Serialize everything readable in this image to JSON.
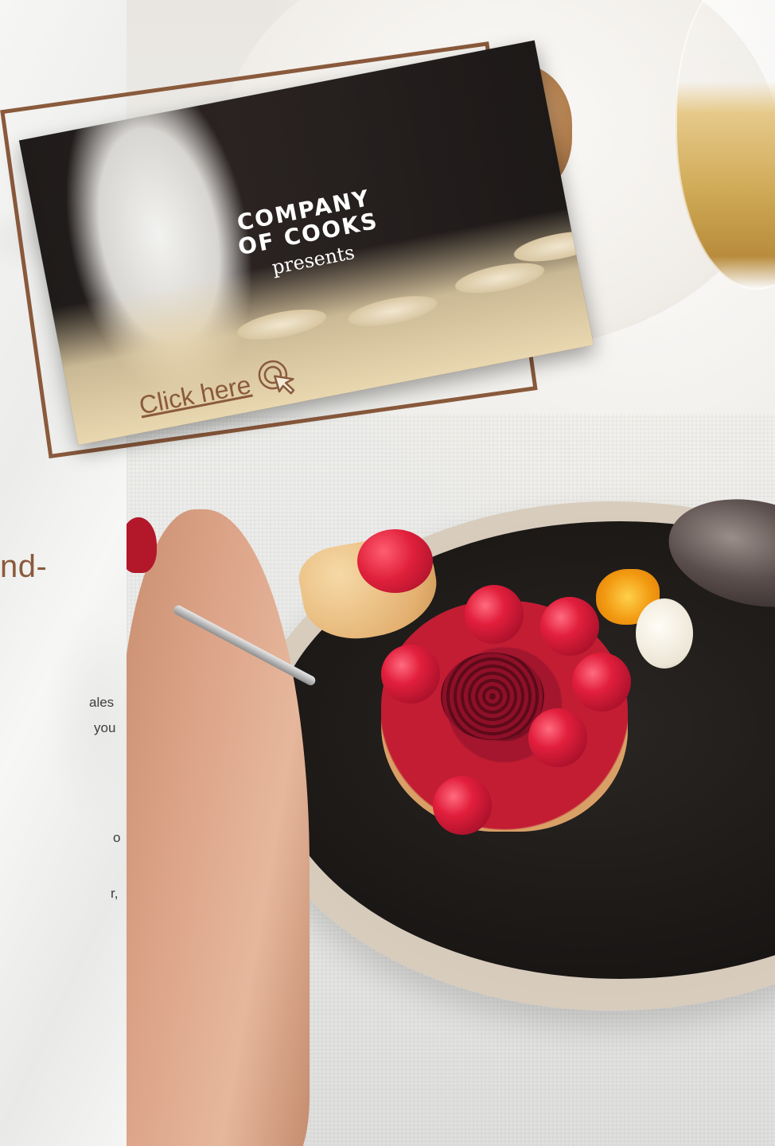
{
  "partial_text": {
    "heading_fragment": "nd-",
    "lines": [
      "ales",
      "you",
      "o",
      "r,"
    ]
  },
  "promo_card": {
    "brand_line1": "COMPANY",
    "brand_line2": "OF COOKS",
    "brand_line3": "presents",
    "cta_label": "Click here",
    "cta_icon": "cursor-click-icon"
  },
  "colors": {
    "accent": "#8a5a3c",
    "text": "#3d3d3d",
    "plate_dark": "#1b1816",
    "raspberry": "#d81f3a"
  }
}
